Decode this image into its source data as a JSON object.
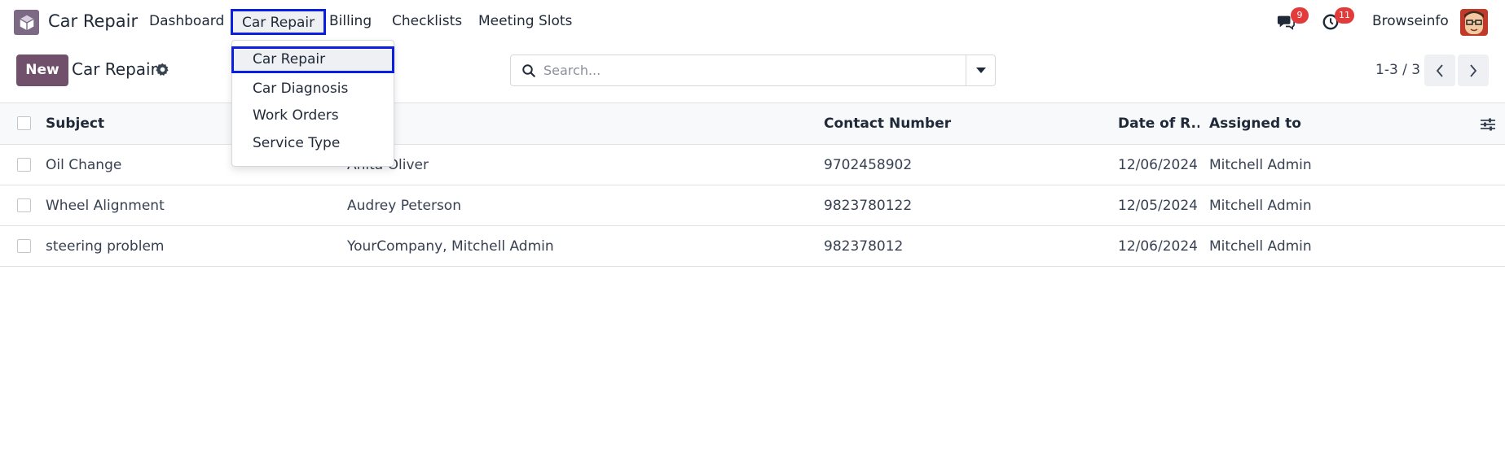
{
  "navbar": {
    "app_name": "Car Repair",
    "menu": [
      {
        "label": "Dashboard"
      },
      {
        "label": "Car Repair"
      },
      {
        "label": "Billing"
      },
      {
        "label": "Checklists"
      },
      {
        "label": "Meeting Slots"
      }
    ],
    "messages_count": "9",
    "activities_count": "11",
    "company": "Browseinfo"
  },
  "control_panel": {
    "new_label": "New",
    "breadcrumb": "Car Repair",
    "search_placeholder": "Search...",
    "pager_value": "1-3 / 3"
  },
  "dropdown": {
    "items": [
      {
        "label": "Car Repair"
      },
      {
        "label": "Car Diagnosis"
      },
      {
        "label": "Work Orders"
      },
      {
        "label": "Service Type"
      }
    ]
  },
  "table": {
    "columns": [
      "Subject",
      "",
      "Contact Number",
      "Date of R...",
      "Assigned to"
    ],
    "rows": [
      {
        "subject": "Oil Change",
        "customer": "Anita Oliver",
        "contact": "9702458902",
        "date": "12/06/2024",
        "assigned": "Mitchell Admin"
      },
      {
        "subject": "Wheel Alignment",
        "customer": "Audrey Peterson",
        "contact": "9823780122",
        "date": "12/05/2024",
        "assigned": "Mitchell Admin"
      },
      {
        "subject": "steering problem",
        "customer": "YourCompany, Mitchell Admin",
        "contact": "982378012",
        "date": "12/06/2024",
        "assigned": "Mitchell Admin"
      }
    ]
  },
  "colors": {
    "primary": "#71506b",
    "highlight_border": "#0b1fe0",
    "badge": "#e23b3b"
  },
  "icons": [
    "app-icon",
    "chat-icon",
    "clock-icon",
    "gear-icon",
    "search-icon",
    "caret-down-icon",
    "chevron-left-icon",
    "chevron-right-icon",
    "optional-columns-icon"
  ]
}
